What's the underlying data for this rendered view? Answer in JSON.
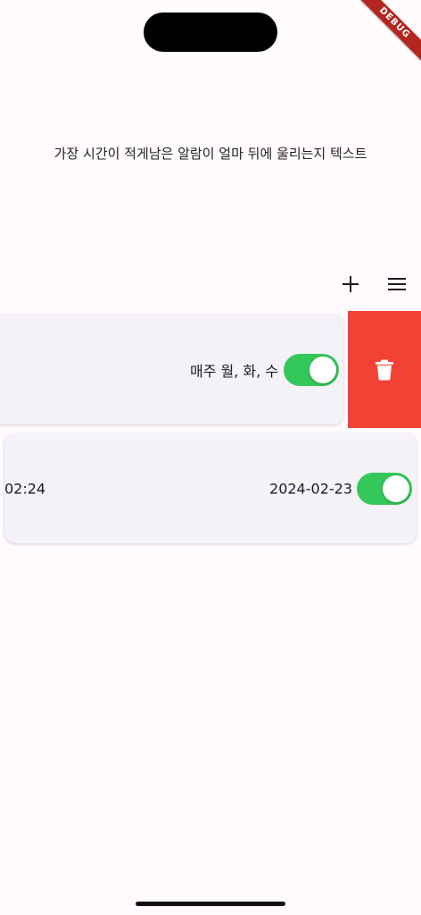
{
  "header": {
    "next_alarm_text": "가장 시간이 적게남은 알람이 얼마 뒤에 울리는지 텍스트"
  },
  "toolbar": {
    "add_icon": "plus-icon",
    "menu_icon": "hamburger-menu-icon"
  },
  "alarms": [
    {
      "repeat": "매주 월, 화, 수",
      "enabled": true,
      "swiped_action": "delete"
    },
    {
      "time": "02:24",
      "date": "2024-02-23",
      "enabled": true
    }
  ],
  "debug_banner": "DEBUG",
  "colors": {
    "toggle_on": "#34c759",
    "delete": "#f24236",
    "card_bg": "#f5f2f8",
    "page_bg": "#fffbfe"
  }
}
